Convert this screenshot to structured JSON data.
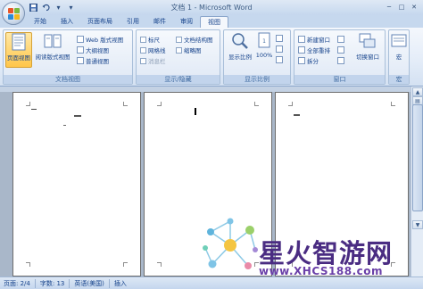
{
  "window": {
    "title": "文档 1 - Microsoft Word"
  },
  "qat": {
    "save_icon": "save-icon",
    "undo_icon": "undo-icon",
    "customize_icon": "customize-icon"
  },
  "window_controls": {
    "minimize": "─",
    "maximize": "□",
    "close": "✕"
  },
  "tabs": [
    {
      "label": "开始"
    },
    {
      "label": "插入"
    },
    {
      "label": "页面布局"
    },
    {
      "label": "引用"
    },
    {
      "label": "邮件"
    },
    {
      "label": "审阅"
    },
    {
      "label": "视图",
      "active": true
    }
  ],
  "ribbon": {
    "doc_views": {
      "label": "文档视图",
      "print_layout": "页面视图",
      "reading": "阅读版式视图",
      "web": "Web 版式视图",
      "outline": "大纲视图",
      "draft": "普通视图"
    },
    "show_hide": {
      "label": "显示/隐藏",
      "ruler": "标尺",
      "gridlines": "网格线",
      "message_bar": "消息栏",
      "doc_map": "文档结构图",
      "thumbnails": "缩略图"
    },
    "zoom": {
      "label": "显示比例",
      "zoom_btn": "显示比例",
      "percent": "100%"
    },
    "window": {
      "label": "窗口",
      "new_window": "新建窗口",
      "arrange_all": "全部重排",
      "split": "拆分",
      "switch": "切换窗口"
    },
    "macros": {
      "label": "宏",
      "btn": "宏"
    }
  },
  "status": {
    "page": "页面: 2/4",
    "words": "字数: 13",
    "language": "英语(美国)",
    "mode": "插入"
  },
  "watermark": {
    "title": "星火智游网",
    "url": "www.XHCS188.com"
  },
  "colors": {
    "ribbon_bg": "#e3ecf8",
    "accent": "#15428b",
    "active_button": "#ffc64a",
    "watermark_purple": "#4a2c82"
  }
}
